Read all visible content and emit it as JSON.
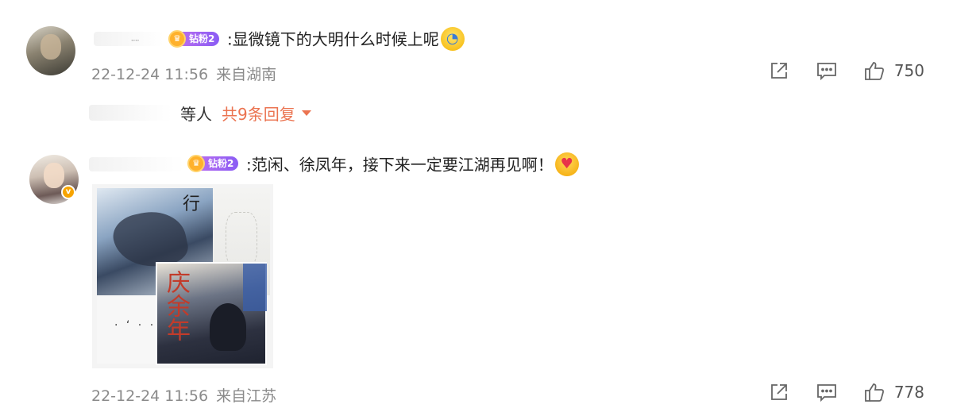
{
  "comments": [
    {
      "badge_label": "钻粉2",
      "text": ":显微镜下的大明什么时候上呢",
      "emoji": "scared-face-emoji",
      "date": "22-12-24 11:56",
      "source": "来自湖南",
      "likes": "750",
      "replies": {
        "suffix": "等人",
        "link": "共9条回复"
      }
    },
    {
      "badge_label": "钻粉2",
      "text": ":范闲、徐凤年，接下来一定要江湖再见啊！",
      "emoji": "heart-eyes-emoji",
      "date": "22-12-24 11:56",
      "source": "来自江苏",
      "likes": "778",
      "images": {
        "poster_title_char": "行",
        "poster_calligraphy": "庆余年"
      }
    }
  ],
  "colors": {
    "reply_link": "#eb7350",
    "meta_gray": "#8a8a8a",
    "badge_purple": "#8a5cf4",
    "verified": "#f7a400"
  },
  "icons": [
    "share-icon",
    "comment-icon",
    "like-icon",
    "chevron-down-icon",
    "verified-icon"
  ]
}
